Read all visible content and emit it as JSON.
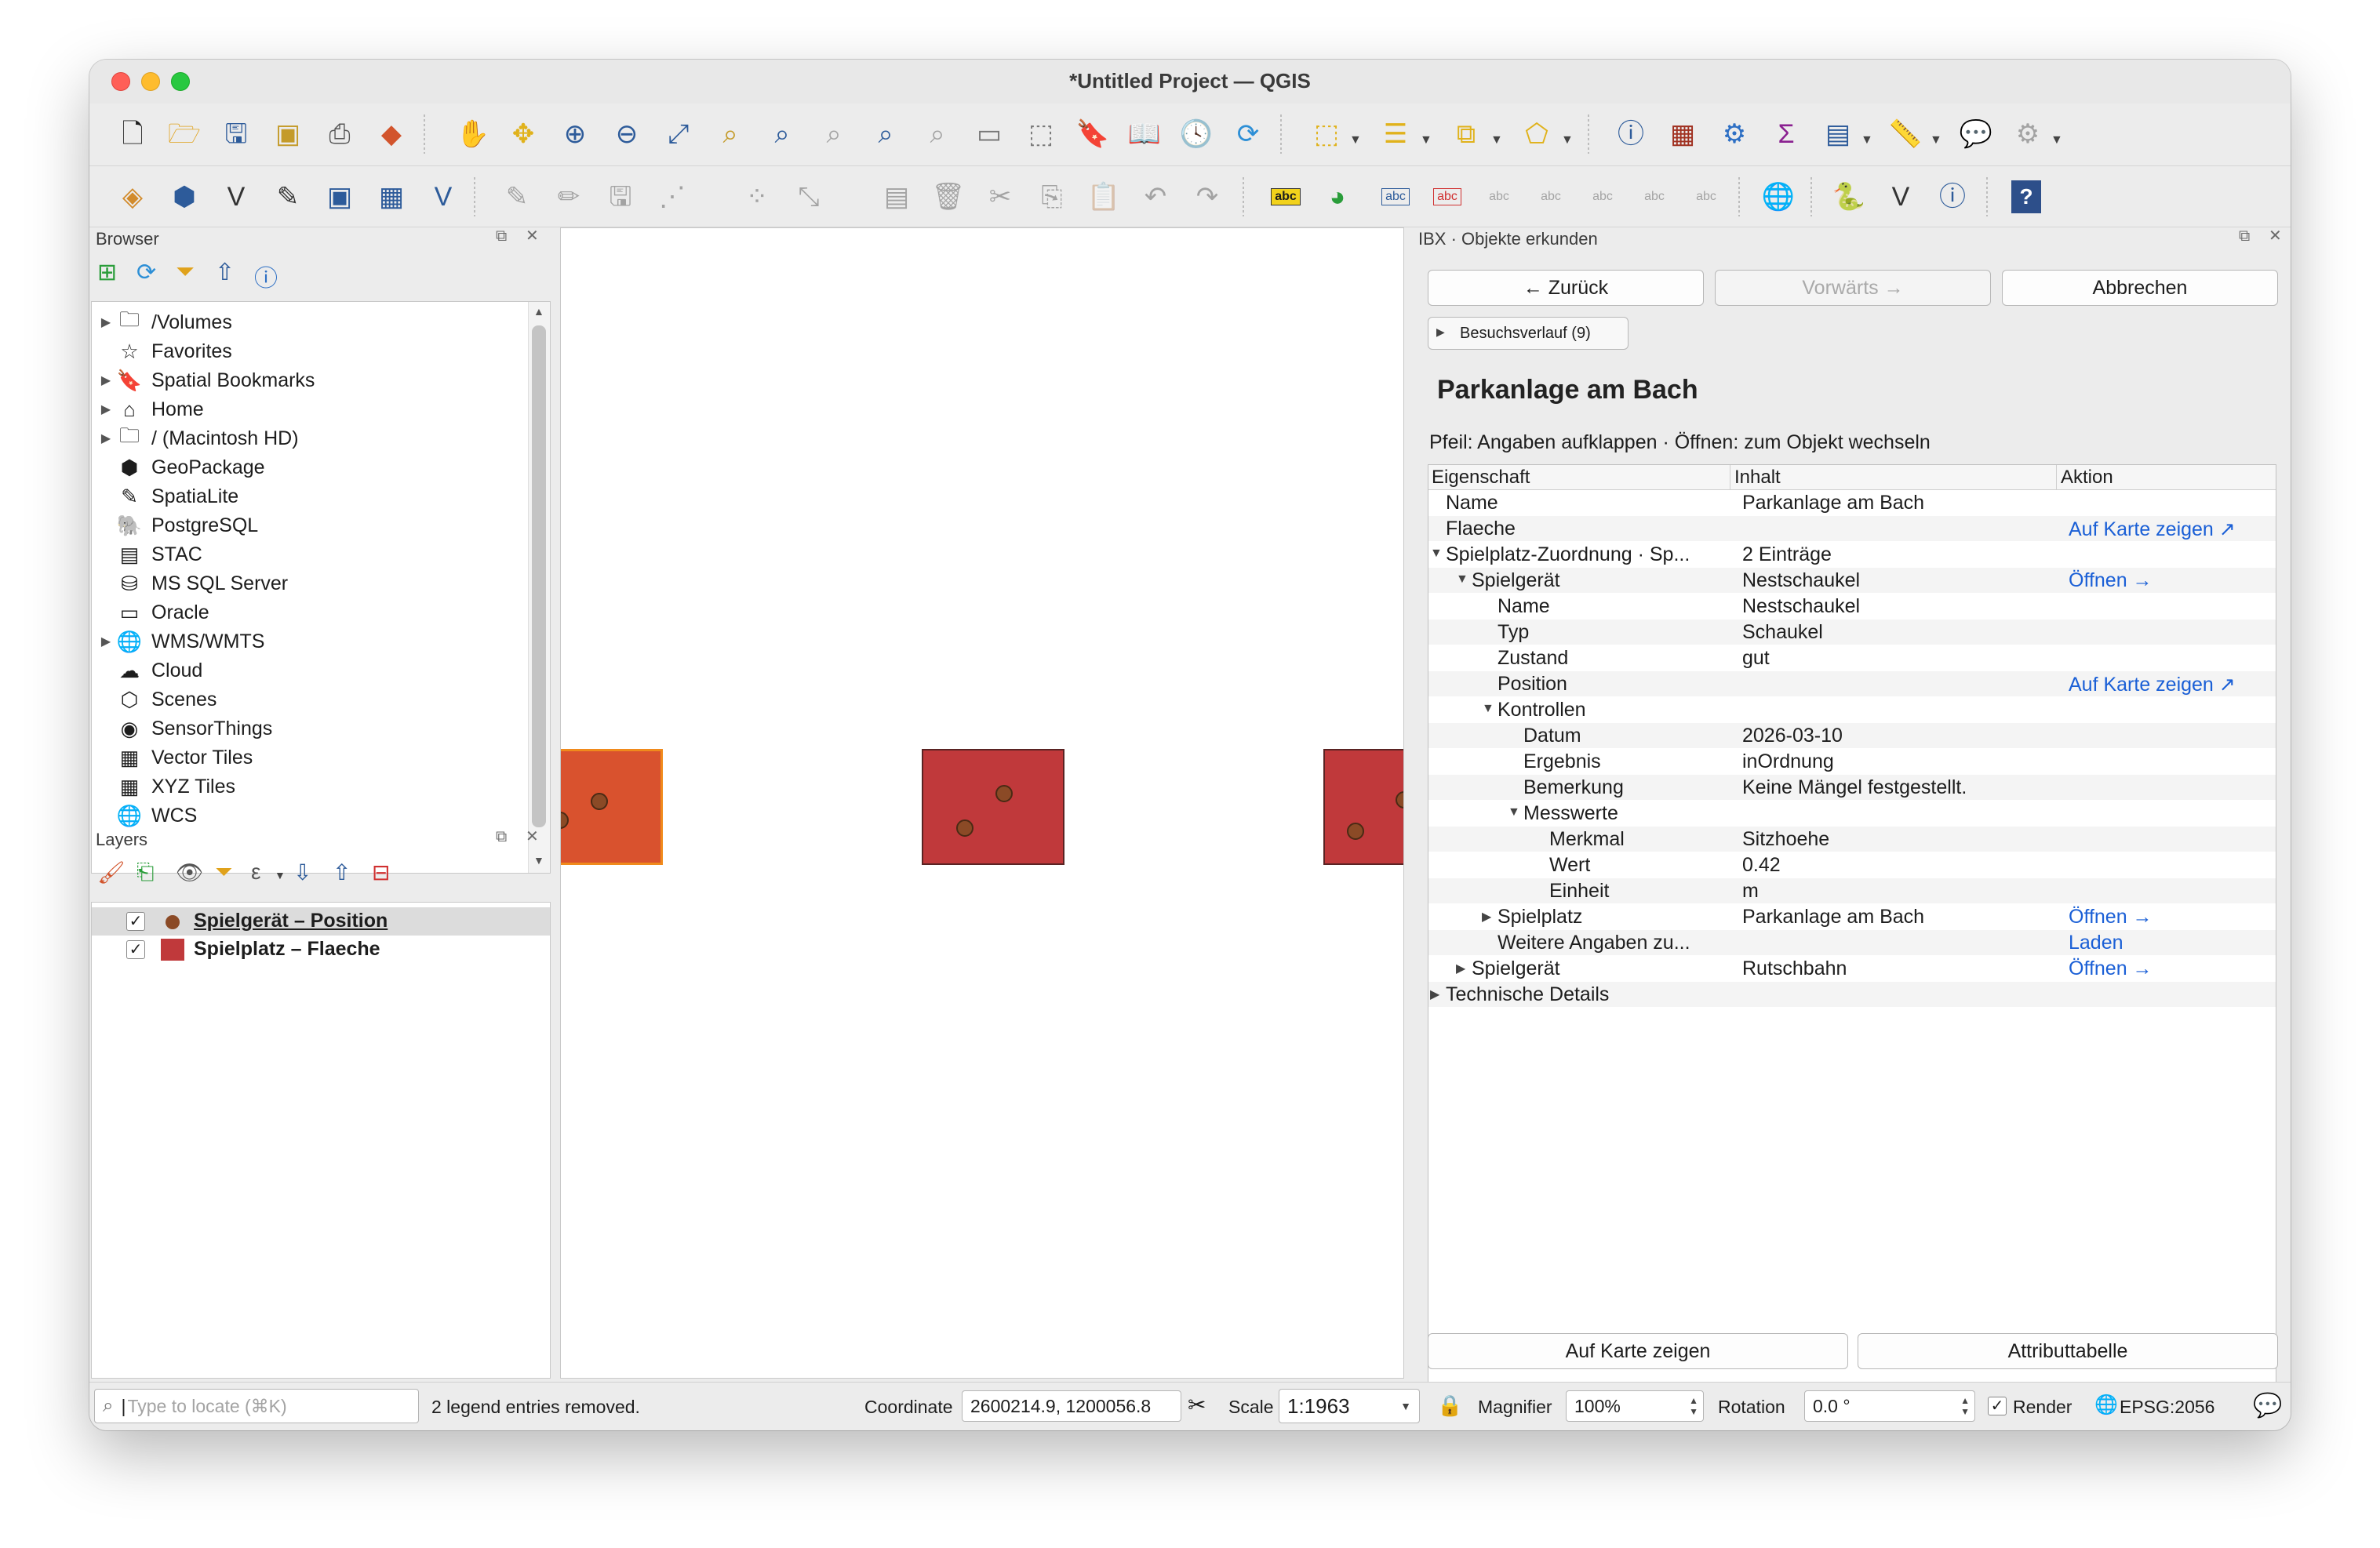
{
  "window": {
    "title": "*Untitled Project — QGIS"
  },
  "toolbar1": [
    "new-project-icon",
    "open-project-icon",
    "save-project-icon",
    "new-print-layout-icon",
    "layout-manager-icon",
    "style-manager-icon",
    "pan-icon",
    "pan-to-selection-icon",
    "zoom-in-icon",
    "zoom-out-icon",
    "zoom-full-icon",
    "zoom-to-selection-icon",
    "zoom-to-layer-icon",
    "zoom-native-icon",
    "zoom-last-icon",
    "zoom-next-icon",
    "new-map-view-icon",
    "new-3d-view-icon",
    "new-bookmark-icon",
    "show-bookmarks-icon",
    "temporal-controller-icon",
    "refresh-icon",
    "select-features-icon",
    "select-by-value-icon",
    "deselect-icon",
    "select-by-location-icon",
    "identify-icon",
    "attribute-table-icon",
    "toolbox-icon",
    "statistics-icon",
    "open-field-calculator-icon",
    "measure-icon",
    "map-tips-icon",
    "annotation-icon"
  ],
  "toolbar2": [
    "data-source-manager-icon",
    "new-geopackage-icon",
    "new-shapefile-icon",
    "new-spatialite-icon",
    "new-temporary-layer-icon",
    "new-virtual-layer-icon",
    "new-mesh-layer-icon",
    "current-edits-icon",
    "toggle-editing-icon",
    "save-edits-icon",
    "digitize-icon",
    "vertex-tool-icon",
    "modify-attributes-icon",
    "delete-selected-icon",
    "cut-features-icon",
    "copy-features-icon",
    "paste-features-icon",
    "undo-icon",
    "redo-icon",
    "label-toolbar-icon",
    "diagram-toolbar-icon",
    "highlight-pinned-labels-icon",
    "pin-labels-icon",
    "show-hide-labels-icon",
    "move-label-icon",
    "rotate-label-icon",
    "change-label-icon",
    "web-plugin-icon",
    "python-console-icon",
    "vertex-editor-icon",
    "identify-plugin-icon",
    "help-icon"
  ],
  "browser": {
    "title": "Browser",
    "items": [
      {
        "label": "/Volumes",
        "icon": "folder-icon",
        "glyph": "🗀",
        "expandable": true
      },
      {
        "label": "Favorites",
        "icon": "star-icon",
        "glyph": "☆",
        "expandable": false
      },
      {
        "label": "Spatial Bookmarks",
        "icon": "bookmark-icon",
        "glyph": "🔖",
        "expandable": true
      },
      {
        "label": "Home",
        "icon": "home-icon",
        "glyph": "⌂",
        "expandable": true
      },
      {
        "label": "/ (Macintosh HD)",
        "icon": "folder-icon",
        "glyph": "🗀",
        "expandable": true
      },
      {
        "label": "GeoPackage",
        "icon": "geopackage-icon",
        "glyph": "⬢",
        "expandable": false
      },
      {
        "label": "SpatiaLite",
        "icon": "spatialite-icon",
        "glyph": "✎",
        "expandable": false
      },
      {
        "label": "PostgreSQL",
        "icon": "postgresql-icon",
        "glyph": "🐘",
        "expandable": false
      },
      {
        "label": "STAC",
        "icon": "stac-icon",
        "glyph": "▤",
        "expandable": false
      },
      {
        "label": "MS SQL Server",
        "icon": "mssql-icon",
        "glyph": "⛁",
        "expandable": false
      },
      {
        "label": "Oracle",
        "icon": "oracle-icon",
        "glyph": "▭",
        "expandable": false
      },
      {
        "label": "WMS/WMTS",
        "icon": "globe-icon",
        "glyph": "🌐",
        "expandable": true
      },
      {
        "label": "Cloud",
        "icon": "cloud-icon",
        "glyph": "☁",
        "expandable": false
      },
      {
        "label": "Scenes",
        "icon": "scenes-icon",
        "glyph": "⬡",
        "expandable": false
      },
      {
        "label": "SensorThings",
        "icon": "sensor-icon",
        "glyph": "◉",
        "expandable": false
      },
      {
        "label": "Vector Tiles",
        "icon": "vector-tiles-icon",
        "glyph": "▦",
        "expandable": false
      },
      {
        "label": "XYZ Tiles",
        "icon": "xyz-tiles-icon",
        "glyph": "▦",
        "expandable": false
      },
      {
        "label": "WCS",
        "icon": "globe-icon",
        "glyph": "🌐",
        "expandable": false
      }
    ]
  },
  "layers": {
    "title": "Layers",
    "items": [
      {
        "label": "Spielgerät – Position",
        "symbol": "point",
        "color": "#8b4a26",
        "checked": true,
        "selected": true
      },
      {
        "label": "Spielplatz – Flaeche",
        "symbol": "polygon",
        "color": "#c0393b",
        "checked": true,
        "selected": false
      }
    ]
  },
  "ibx": {
    "title": "IBX · Objekte erkunden",
    "back": "← Zurück",
    "forward": "Vorwärts →",
    "cancel": "Abbrechen",
    "history": "Besuchsverlauf (9)",
    "heading": "Parkanlage am Bach",
    "hint": "Pfeil: Angaben aufklappen · Öffnen: zum Objekt wechseln",
    "columns": [
      "Eigenschaft",
      "Inhalt",
      "Aktion"
    ],
    "rows": [
      {
        "level": 0,
        "arrow": "",
        "prop": "Name",
        "value": "Parkanlage am Bach",
        "action": ""
      },
      {
        "level": 0,
        "arrow": "",
        "prop": "Flaeche",
        "value": "",
        "action": "Auf Karte zeigen ↗"
      },
      {
        "level": 0,
        "arrow": "open",
        "prop": "Spielplatz-Zuordnung · Sp...",
        "value": "2 Einträge",
        "action": ""
      },
      {
        "level": 1,
        "arrow": "open",
        "prop": "Spielgerät",
        "value": "Nestschaukel",
        "action": "Öffnen →"
      },
      {
        "level": 2,
        "arrow": "",
        "prop": "Name",
        "value": "Nestschaukel",
        "action": ""
      },
      {
        "level": 2,
        "arrow": "",
        "prop": "Typ",
        "value": "Schaukel",
        "action": ""
      },
      {
        "level": 2,
        "arrow": "",
        "prop": "Zustand",
        "value": "gut",
        "action": ""
      },
      {
        "level": 2,
        "arrow": "",
        "prop": "Position",
        "value": "",
        "action": "Auf Karte zeigen ↗"
      },
      {
        "level": 2,
        "arrow": "open",
        "prop": "Kontrollen",
        "value": "",
        "action": ""
      },
      {
        "level": 3,
        "arrow": "",
        "prop": "Datum",
        "value": "2026-03-10",
        "action": ""
      },
      {
        "level": 3,
        "arrow": "",
        "prop": "Ergebnis",
        "value": "inOrdnung",
        "action": ""
      },
      {
        "level": 3,
        "arrow": "",
        "prop": "Bemerkung",
        "value": "Keine Mängel festgestellt.",
        "action": ""
      },
      {
        "level": 3,
        "arrow": "open",
        "prop": "Messwerte",
        "value": "",
        "action": ""
      },
      {
        "level": 4,
        "arrow": "",
        "prop": "Merkmal",
        "value": "Sitzhoehe",
        "action": ""
      },
      {
        "level": 4,
        "arrow": "",
        "prop": "Wert",
        "value": "0.42",
        "action": ""
      },
      {
        "level": 4,
        "arrow": "",
        "prop": "Einheit",
        "value": "m",
        "action": ""
      },
      {
        "level": 2,
        "arrow": "closed",
        "prop": "Spielplatz",
        "value": "Parkanlage am Bach",
        "action": "Öffnen →"
      },
      {
        "level": 2,
        "arrow": "",
        "prop": "Weitere Angaben zu...",
        "value": "",
        "action": "Laden"
      },
      {
        "level": 1,
        "arrow": "closed",
        "prop": "Spielgerät",
        "value": "Rutschbahn",
        "action": "Öffnen →"
      },
      {
        "level": 0,
        "arrow": "closed",
        "prop": "Technische Details",
        "value": "",
        "action": ""
      }
    ],
    "show_on_map": "Auf Karte zeigen",
    "attribute_table": "Attributtabelle"
  },
  "status": {
    "locator_placeholder": "Type to locate (⌘K)",
    "message": "2 legend entries removed.",
    "coordinate_label": "Coordinate",
    "coordinate_value": "2600214.9, 1200056.8",
    "scale_label": "Scale",
    "scale_value": "1:1963",
    "magnifier_label": "Magnifier",
    "magnifier_value": "100%",
    "rotation_label": "Rotation",
    "rotation_value": "0.0 °",
    "render_label": "Render",
    "crs": "EPSG:2056"
  },
  "colors": {
    "polygon_fill": "#c0393b",
    "selected_polygon_fill": "#d9522e",
    "selection_outline": "#f08a1c",
    "point_fill": "#8b4a26",
    "link": "#1a5fd6"
  }
}
